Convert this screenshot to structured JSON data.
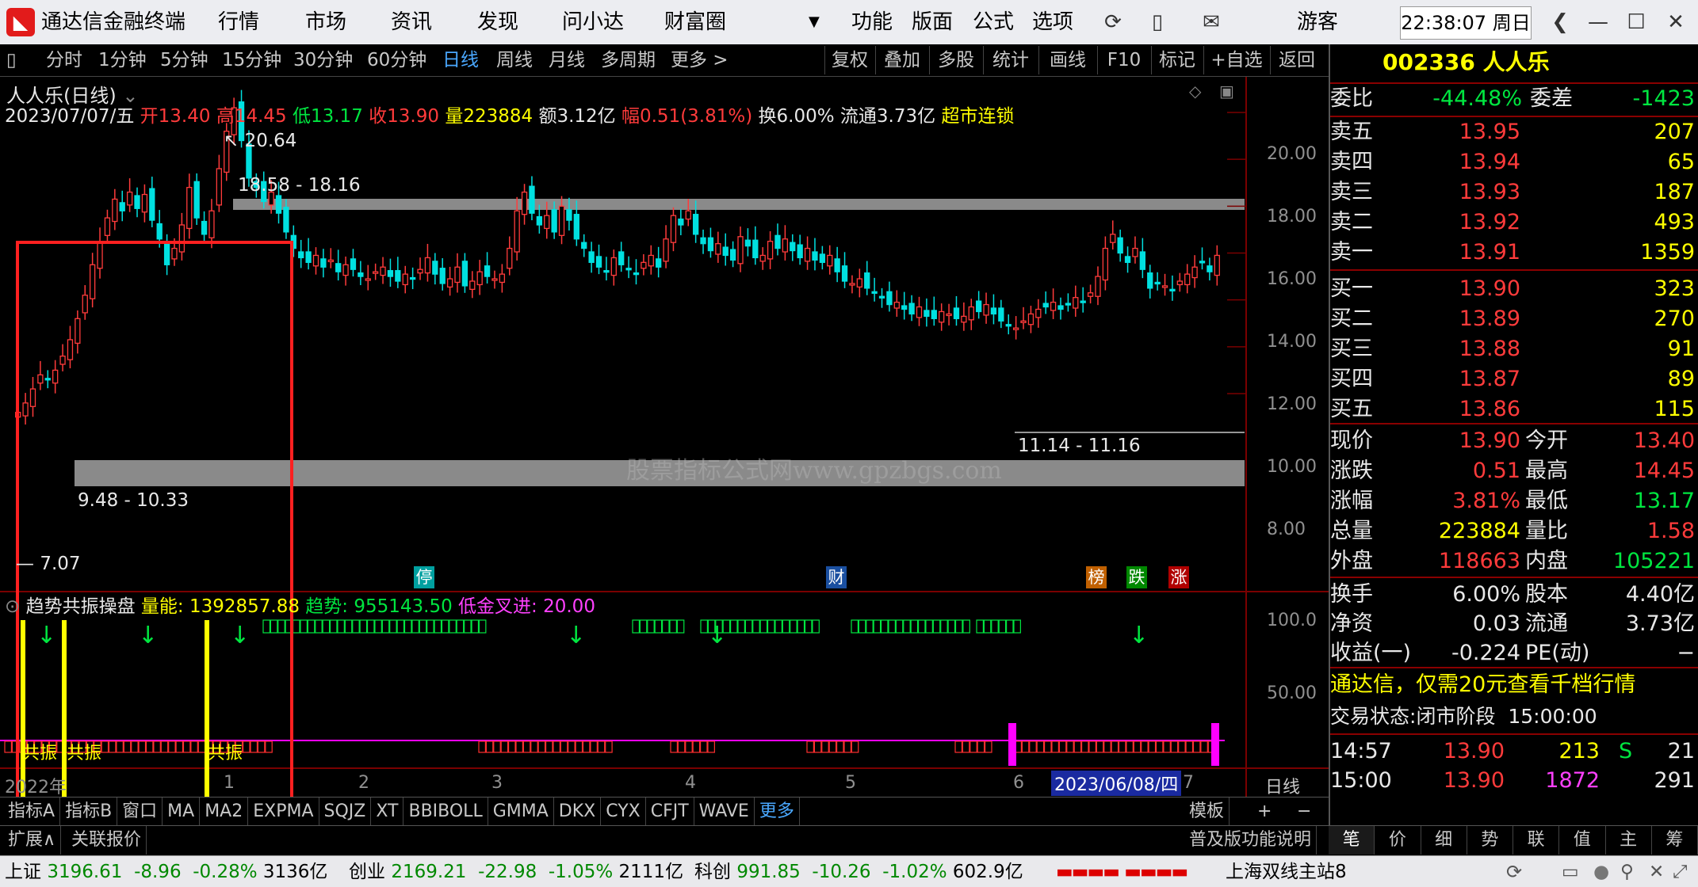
{
  "app": {
    "title": "通达信金融终端",
    "menu": [
      "行情",
      "市场",
      "资讯",
      "发现",
      "问小达",
      "财富圈"
    ],
    "menu_right": [
      "功能",
      "版面",
      "公式",
      "选项"
    ],
    "user": "游客",
    "clock": "22:38:07 周日"
  },
  "period_tabs": [
    "分时",
    "1分钟",
    "5分钟",
    "15分钟",
    "30分钟",
    "60分钟",
    "日线",
    "周线",
    "月线",
    "多周期",
    "更多 >"
  ],
  "active_period": "日线",
  "toolbar_buttons": [
    "复权",
    "叠加",
    "多股",
    "统计",
    "画线",
    "F10",
    "标记",
    "+自选",
    "返回"
  ],
  "chart_header": {
    "name": "人人乐(日线)",
    "date": "2023/07/07/五",
    "open_label": "开",
    "open": "13.40",
    "high_label": "高",
    "high": "14.45",
    "low_label": "低",
    "low": "13.17",
    "close_label": "收",
    "close": "13.90",
    "vol_label": "量",
    "vol": "223884",
    "amount_label": "额",
    "amount": "3.12亿",
    "amp_label": "幅",
    "amp": "0.51(3.81%)",
    "turn": "换6.00%",
    "float": "流通3.73亿",
    "tag": "超市连锁"
  },
  "price_axis": [
    "20.00",
    "18.00",
    "16.00",
    "14.00",
    "12.00",
    "10.00",
    "8.00"
  ],
  "annotations": {
    "high_mark": "20.64",
    "low_mark": "7.07",
    "zone_top": "18.58 - 18.16",
    "zone_mid": "11.14 - 11.16",
    "zone_low": "9.48 - 10.33",
    "watermark": "股票指标公式网www.gpzbgs.com"
  },
  "event_markers": [
    {
      "text": "停",
      "color": "#00a0a0"
    },
    {
      "text": "财",
      "color": "#1a4fa0"
    },
    {
      "text": "榜",
      "color": "#c06000"
    },
    {
      "text": "跌",
      "color": "#008800"
    },
    {
      "text": "涨",
      "color": "#b00000"
    }
  ],
  "indicator": {
    "name": "趋势共振操盘",
    "vol_label": "量能: 1392857.88",
    "trend_label": "趋势: 955143.50",
    "cross_label": "低金叉进: 20.00",
    "axis": [
      "100.0",
      "50.00"
    ],
    "resonance": [
      "共振",
      "共振",
      "共振"
    ]
  },
  "date_axis": [
    "2022年",
    "1",
    "2",
    "3",
    "4",
    "5",
    "6",
    "2023/06/08/四",
    "7"
  ],
  "date_axis_tag": "日线",
  "bottom_tabs": [
    "指标A",
    "指标B",
    "窗口",
    "MA",
    "MA2",
    "EXPMA",
    "SQJZ",
    "XT",
    "BBIBOLL",
    "GMMA",
    "DKX",
    "CYX",
    "CFJT",
    "WAVE",
    "更多"
  ],
  "bottom_right": [
    "模板",
    "+",
    "−"
  ],
  "ext_bar": [
    "扩展∧",
    "关联报价"
  ],
  "ext_right": "普及版功能说明",
  "right_tabs": [
    "笔",
    "价",
    "细",
    "势",
    "联",
    "值",
    "主",
    "筹"
  ],
  "quote": {
    "code": "002336",
    "name": "人人乐",
    "weibi_label": "委比",
    "weibi": "-44.48%",
    "weicha_label": "委差",
    "weicha": "-1423",
    "asks": [
      {
        "label": "卖五",
        "price": "13.95",
        "vol": "207"
      },
      {
        "label": "卖四",
        "price": "13.94",
        "vol": "65"
      },
      {
        "label": "卖三",
        "price": "13.93",
        "vol": "187"
      },
      {
        "label": "卖二",
        "price": "13.92",
        "vol": "493"
      },
      {
        "label": "卖一",
        "price": "13.91",
        "vol": "1359"
      }
    ],
    "bids": [
      {
        "label": "买一",
        "price": "13.90",
        "vol": "323"
      },
      {
        "label": "买二",
        "price": "13.89",
        "vol": "270"
      },
      {
        "label": "买三",
        "price": "13.88",
        "vol": "91"
      },
      {
        "label": "买四",
        "price": "13.87",
        "vol": "89"
      },
      {
        "label": "买五",
        "price": "13.86",
        "vol": "115"
      }
    ],
    "stats": [
      {
        "l1": "现价",
        "v1": "13.90",
        "c1": "red",
        "l2": "今开",
        "v2": "13.40",
        "c2": "red"
      },
      {
        "l1": "涨跌",
        "v1": "0.51",
        "c1": "red",
        "l2": "最高",
        "v2": "14.45",
        "c2": "red"
      },
      {
        "l1": "涨幅",
        "v1": "3.81%",
        "c1": "red",
        "l2": "最低",
        "v2": "13.17",
        "c2": "grn"
      },
      {
        "l1": "总量",
        "v1": "223884",
        "c1": "yel",
        "l2": "量比",
        "v2": "1.58",
        "c2": "red"
      },
      {
        "l1": "外盘",
        "v1": "118663",
        "c1": "red",
        "l2": "内盘",
        "v2": "105221",
        "c2": "grn"
      }
    ],
    "stats2": [
      {
        "l1": "换手",
        "v1": "6.00%",
        "l2": "股本",
        "v2": "4.40亿"
      },
      {
        "l1": "净资",
        "v1": "0.03",
        "l2": "流通",
        "v2": "3.73亿"
      },
      {
        "l1": "收益(一)",
        "v1": "-0.224",
        "l2": "PE(动)",
        "v2": "−"
      }
    ],
    "promo": "通达信，仅需20元查看千档行情",
    "trade_state_label": "交易状态:",
    "trade_state": "闭市阶段",
    "trade_time": "15:00:00",
    "ticks": [
      {
        "time": "14:57",
        "price": "13.90",
        "vol": "213",
        "flag": "S",
        "n": "21"
      },
      {
        "time": "15:00",
        "price": "13.90",
        "vol": "1872",
        "flag": "",
        "n": "291"
      }
    ]
  },
  "status_bar": {
    "sh_label": "上证",
    "sh": "3196.61",
    "sh_chg": "-8.96",
    "sh_pct": "-0.28%",
    "sh_amt": "3136亿",
    "cy_label": "创业",
    "cy": "2169.21",
    "cy_chg": "-22.98",
    "cy_pct": "-1.05%",
    "cy_amt": "2111亿",
    "kc_label": "科创",
    "kc": "991.85",
    "kc_chg": "-10.26",
    "kc_pct": "-1.02%",
    "kc_amt": "602.9亿",
    "server": "上海双线主站8"
  },
  "colors": {
    "up": "#ff3b3b",
    "down": "#00e0e0",
    "highlight_box": "#ff2020",
    "resonance": "#ffff00",
    "signal": "#00ff00"
  }
}
